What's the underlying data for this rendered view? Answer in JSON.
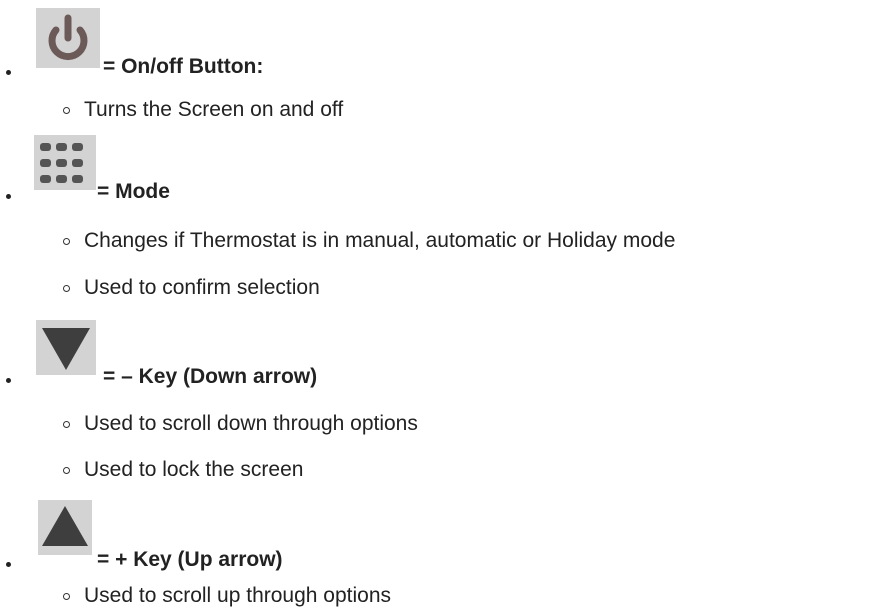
{
  "items": [
    {
      "icon": "power-icon",
      "heading": "= On/off Button:",
      "subs": [
        "Turns the Screen on and off"
      ]
    },
    {
      "icon": "grid-icon",
      "heading": "= Mode",
      "subs": [
        "Changes if Thermostat is in manual, automatic or Holiday mode",
        "Used to confirm selection"
      ]
    },
    {
      "icon": "down-arrow-icon",
      "heading": "= – Key (Down arrow)",
      "subs": [
        "Used to scroll down through options",
        "Used to lock the screen"
      ]
    },
    {
      "icon": "up-arrow-icon",
      "heading": "= + Key (Up arrow)",
      "subs": [
        "Used to scroll up through options"
      ]
    }
  ]
}
